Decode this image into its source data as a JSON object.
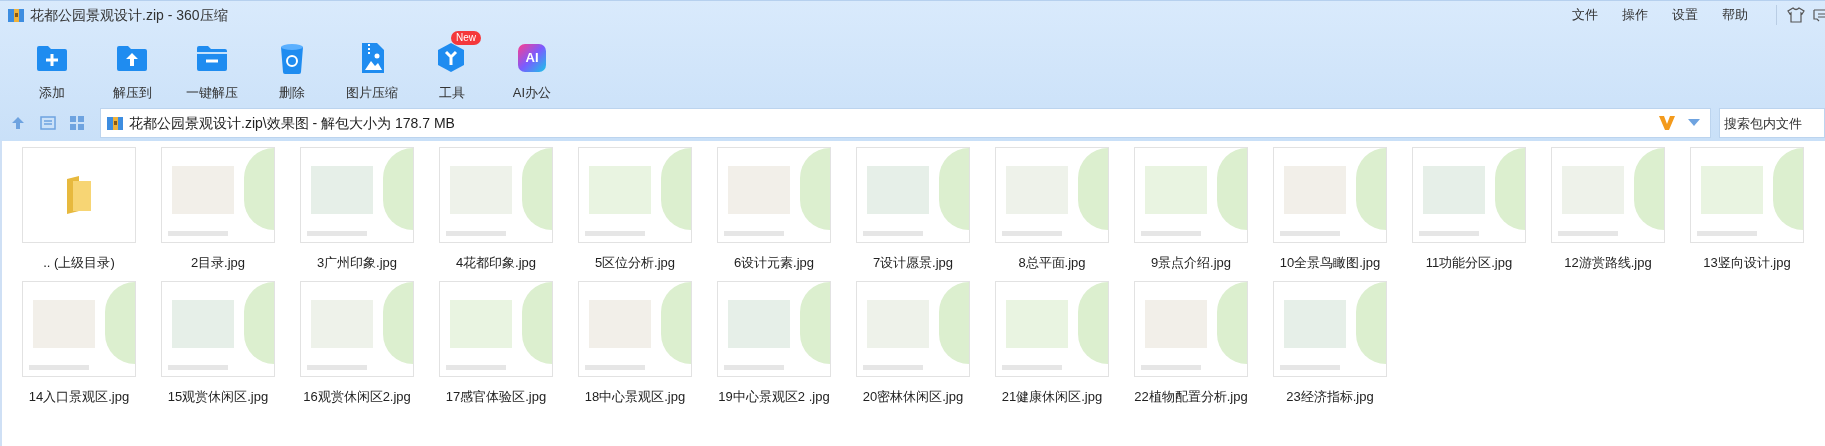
{
  "window": {
    "title": "花都公园景观设计.zip - 360压缩"
  },
  "menu": [
    "文件",
    "操作",
    "设置",
    "帮助"
  ],
  "toolbar": [
    {
      "kind": "add",
      "label": "添加"
    },
    {
      "kind": "extract",
      "label": "解压到"
    },
    {
      "kind": "oneclick",
      "label": "一键解压"
    },
    {
      "kind": "delete",
      "label": "删除"
    },
    {
      "kind": "image",
      "label": "图片压缩"
    },
    {
      "kind": "tools",
      "label": "工具",
      "badge": "New"
    },
    {
      "kind": "ai",
      "label": "AI办公",
      "icon_text": "AI"
    }
  ],
  "address": {
    "path": "花都公园景观设计.zip\\效果图 - 解包大小为 178.7 MB"
  },
  "search": {
    "placeholder": "搜索包内文件"
  },
  "files": [
    {
      "kind": "folder",
      "name": ".. (上级目录)"
    },
    {
      "kind": "image",
      "name": "2目录.jpg"
    },
    {
      "kind": "image",
      "name": "3广州印象.jpg"
    },
    {
      "kind": "image",
      "name": "4花都印象.jpg"
    },
    {
      "kind": "image",
      "name": "5区位分析.jpg"
    },
    {
      "kind": "image",
      "name": "6设计元素.jpg"
    },
    {
      "kind": "image",
      "name": "7设计愿景.jpg"
    },
    {
      "kind": "image",
      "name": "8总平面.jpg"
    },
    {
      "kind": "image",
      "name": "9景点介绍.jpg"
    },
    {
      "kind": "image",
      "name": "10全景鸟瞰图.jpg"
    },
    {
      "kind": "image",
      "name": "11功能分区.jpg"
    },
    {
      "kind": "image",
      "name": "12游赏路线.jpg"
    },
    {
      "kind": "image",
      "name": "13竖向设计.jpg"
    },
    {
      "kind": "image",
      "name": "14入口景观区.jpg"
    },
    {
      "kind": "image",
      "name": "15观赏休闲区.jpg"
    },
    {
      "kind": "image",
      "name": "16观赏休闲区2.jpg"
    },
    {
      "kind": "image",
      "name": "17感官体验区.jpg"
    },
    {
      "kind": "image",
      "name": "18中心景观区.jpg"
    },
    {
      "kind": "image",
      "name": "19中心景观区2 .jpg"
    },
    {
      "kind": "image",
      "name": "20密林休闲区.jpg"
    },
    {
      "kind": "image",
      "name": "21健康休闲区.jpg"
    },
    {
      "kind": "image",
      "name": "22植物配置分析.jpg"
    },
    {
      "kind": "image",
      "name": "23经济指标.jpg"
    }
  ]
}
